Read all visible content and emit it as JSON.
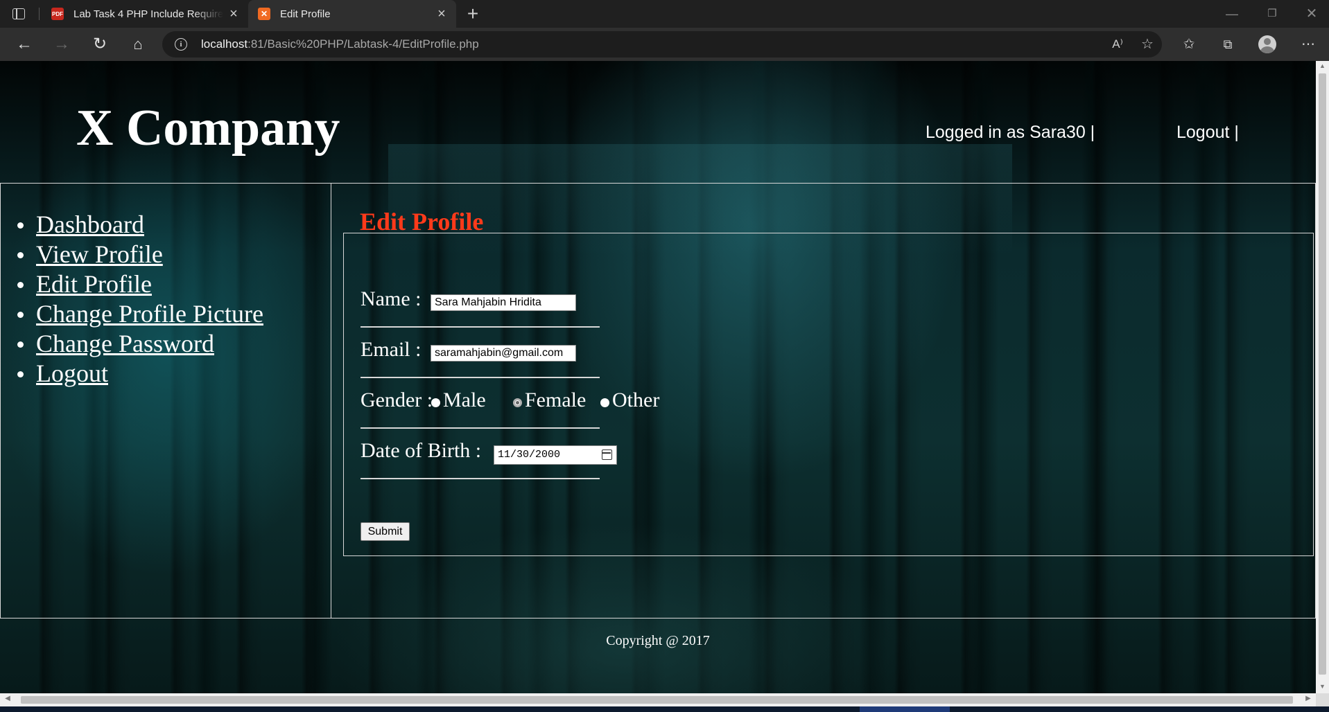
{
  "browser": {
    "tabs": [
      {
        "title": "Lab Task 4 PHP Include Require w",
        "favicon": "pdf-icon",
        "active": false
      },
      {
        "title": "Edit Profile",
        "favicon": "xampp-icon",
        "active": true
      }
    ],
    "new_tab_label": "+",
    "url_host": "localhost",
    "url_rest": ":81/Basic%20PHP/Labtask-4/EditProfile.php",
    "read_aloud_label": "A⁾"
  },
  "header": {
    "site_title": "X Company",
    "login_text": "Logged in as Sara30 |",
    "logout_text": "Logout |"
  },
  "sidebar": {
    "items": [
      {
        "label": "Dashboard"
      },
      {
        "label": "View Profile"
      },
      {
        "label": "Edit Profile"
      },
      {
        "label": "Change Profile Picture"
      },
      {
        "label": "Change Password"
      },
      {
        "label": "Logout"
      }
    ]
  },
  "form": {
    "legend": "Edit Profile",
    "name_label": "Name :",
    "name_value": "Sara Mahjabin Hridita",
    "email_label": "Email :",
    "email_value": "saramahjabin@gmail.com",
    "gender_label": "Gender :",
    "gender_options": [
      "Male",
      "Female",
      "Other"
    ],
    "gender_selected": "Female",
    "dob_label": "Date of Birth :",
    "dob_value": "11/30/2000",
    "submit_label": "Submit"
  },
  "footer": {
    "copyright": "Copyright @ 2017"
  },
  "colors": {
    "legend": "#ff3a1a",
    "text": "#ffffff"
  }
}
